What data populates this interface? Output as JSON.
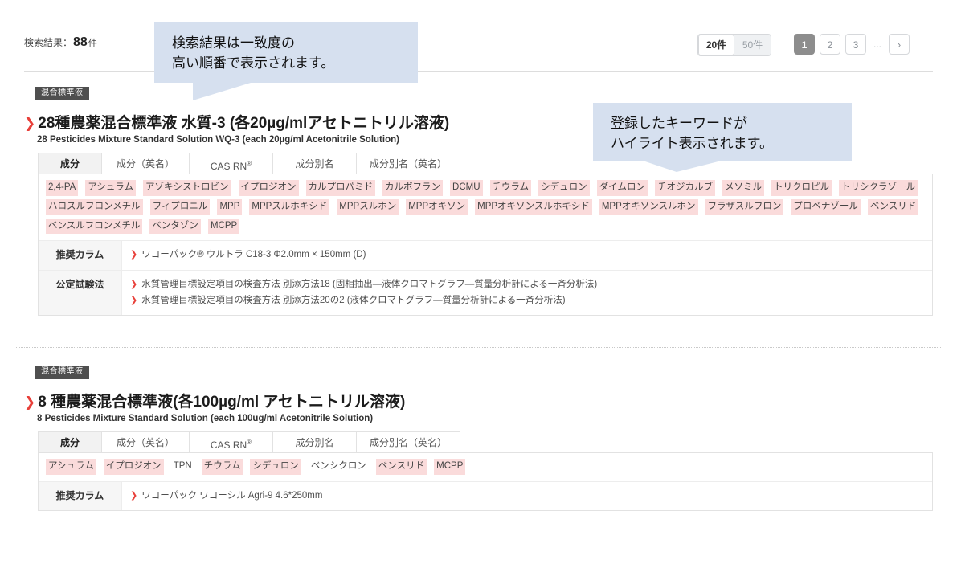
{
  "header": {
    "result_label": "検索結果：",
    "result_count": "88",
    "result_unit": "件"
  },
  "perpage": {
    "options": [
      {
        "label": "20件",
        "active": true
      },
      {
        "label": "50件",
        "active": false
      }
    ]
  },
  "pagination": {
    "pages": [
      {
        "label": "1",
        "current": true
      },
      {
        "label": "2",
        "current": false
      },
      {
        "label": "3",
        "current": false
      }
    ],
    "ellipsis": "...",
    "next_icon": "›"
  },
  "callouts": [
    {
      "text": "検索結果は一致度の\n高い順番で表示されます。"
    },
    {
      "text": "登録したキーワードが\nハイライト表示されます。"
    }
  ],
  "results": [
    {
      "badge": "混合標準液",
      "chevron": "❯",
      "title_ja": "28種農薬混合標準液 水質-3 (各20µg/mlアセトニトリル溶液)",
      "title_en": "28 Pesticides Mixture Standard Solution WQ-3 (each 20µg/ml Acetonitrile Solution)",
      "tabs": [
        {
          "label": "成分",
          "active": true
        },
        {
          "label": "成分（英名）",
          "active": false
        },
        {
          "label": "CAS RN",
          "sup": "®",
          "active": false
        },
        {
          "label": "成分別名",
          "active": false
        },
        {
          "label": "成分別名（英名）",
          "active": false
        }
      ],
      "tags": [
        {
          "text": "2,4-PA",
          "highlighted": true
        },
        {
          "text": "アシュラム",
          "highlighted": true
        },
        {
          "text": "アゾキシストロビン",
          "highlighted": true
        },
        {
          "text": "イプロジオン",
          "highlighted": true
        },
        {
          "text": "カルプロパミド",
          "highlighted": true
        },
        {
          "text": "カルボフラン",
          "highlighted": true
        },
        {
          "text": "DCMU",
          "highlighted": true
        },
        {
          "text": "チウラム",
          "highlighted": true
        },
        {
          "text": "シデュロン",
          "highlighted": true
        },
        {
          "text": "ダイムロン",
          "highlighted": true
        },
        {
          "text": "チオジカルブ",
          "highlighted": true
        },
        {
          "text": "メソミル",
          "highlighted": true
        },
        {
          "text": "トリクロピル",
          "highlighted": true
        },
        {
          "text": "トリシクラゾール",
          "highlighted": true
        },
        {
          "text": "ハロスルフロンメチル",
          "highlighted": true
        },
        {
          "text": "フィプロニル",
          "highlighted": true
        },
        {
          "text": "MPP",
          "highlighted": true
        },
        {
          "text": "MPPスルホキシド",
          "highlighted": true
        },
        {
          "text": "MPPスルホン",
          "highlighted": true
        },
        {
          "text": "MPPオキソン",
          "highlighted": true
        },
        {
          "text": "MPPオキソンスルホキシド",
          "highlighted": true
        },
        {
          "text": "MPPオキソンスルホン",
          "highlighted": true
        },
        {
          "text": "フラザスルフロン",
          "highlighted": true
        },
        {
          "text": "プロベナゾール",
          "highlighted": true
        },
        {
          "text": "ベンスリド",
          "highlighted": true
        },
        {
          "text": "ベンスルフロンメチル",
          "highlighted": true
        },
        {
          "text": "ベンタゾン",
          "highlighted": true
        },
        {
          "text": "MCPP",
          "highlighted": true
        }
      ],
      "rows": [
        {
          "label": "推奨カラム",
          "links": [
            "ワコーパック® ウルトラ C18-3 Φ2.0mm × 150mm (D)"
          ]
        },
        {
          "label": "公定試験法",
          "links": [
            "水質管理目標設定項目の検査方法 別添方法18 (固相抽出—液体クロマトグラフ—質量分析計による一斉分析法)",
            "水質管理目標設定項目の検査方法 別添方法20の2 (液体クロマトグラフ—質量分析計による一斉分析法)"
          ]
        }
      ]
    },
    {
      "badge": "混合標準液",
      "chevron": "❯",
      "title_ja": "8 種農薬混合標準液(各100µg/ml アセトニトリル溶液)",
      "title_en": "8 Pesticides Mixture Standard Solution (each 100ug/ml Acetonitrile Solution)",
      "tabs": [
        {
          "label": "成分",
          "active": true
        },
        {
          "label": "成分（英名）",
          "active": false
        },
        {
          "label": "CAS RN",
          "sup": "®",
          "active": false
        },
        {
          "label": "成分別名",
          "active": false
        },
        {
          "label": "成分別名（英名）",
          "active": false
        }
      ],
      "tags": [
        {
          "text": "アシュラム",
          "highlighted": true
        },
        {
          "text": "イプロジオン",
          "highlighted": true
        },
        {
          "text": "TPN",
          "highlighted": false
        },
        {
          "text": "チウラム",
          "highlighted": true
        },
        {
          "text": "シデュロン",
          "highlighted": true
        },
        {
          "text": "ベンシクロン",
          "highlighted": false
        },
        {
          "text": "ベンスリド",
          "highlighted": true
        },
        {
          "text": "MCPP",
          "highlighted": true
        }
      ],
      "rows": [
        {
          "label": "推奨カラム",
          "links": [
            "ワコーパック ワコーシル Agri-9 4.6*250mm"
          ]
        }
      ]
    }
  ]
}
